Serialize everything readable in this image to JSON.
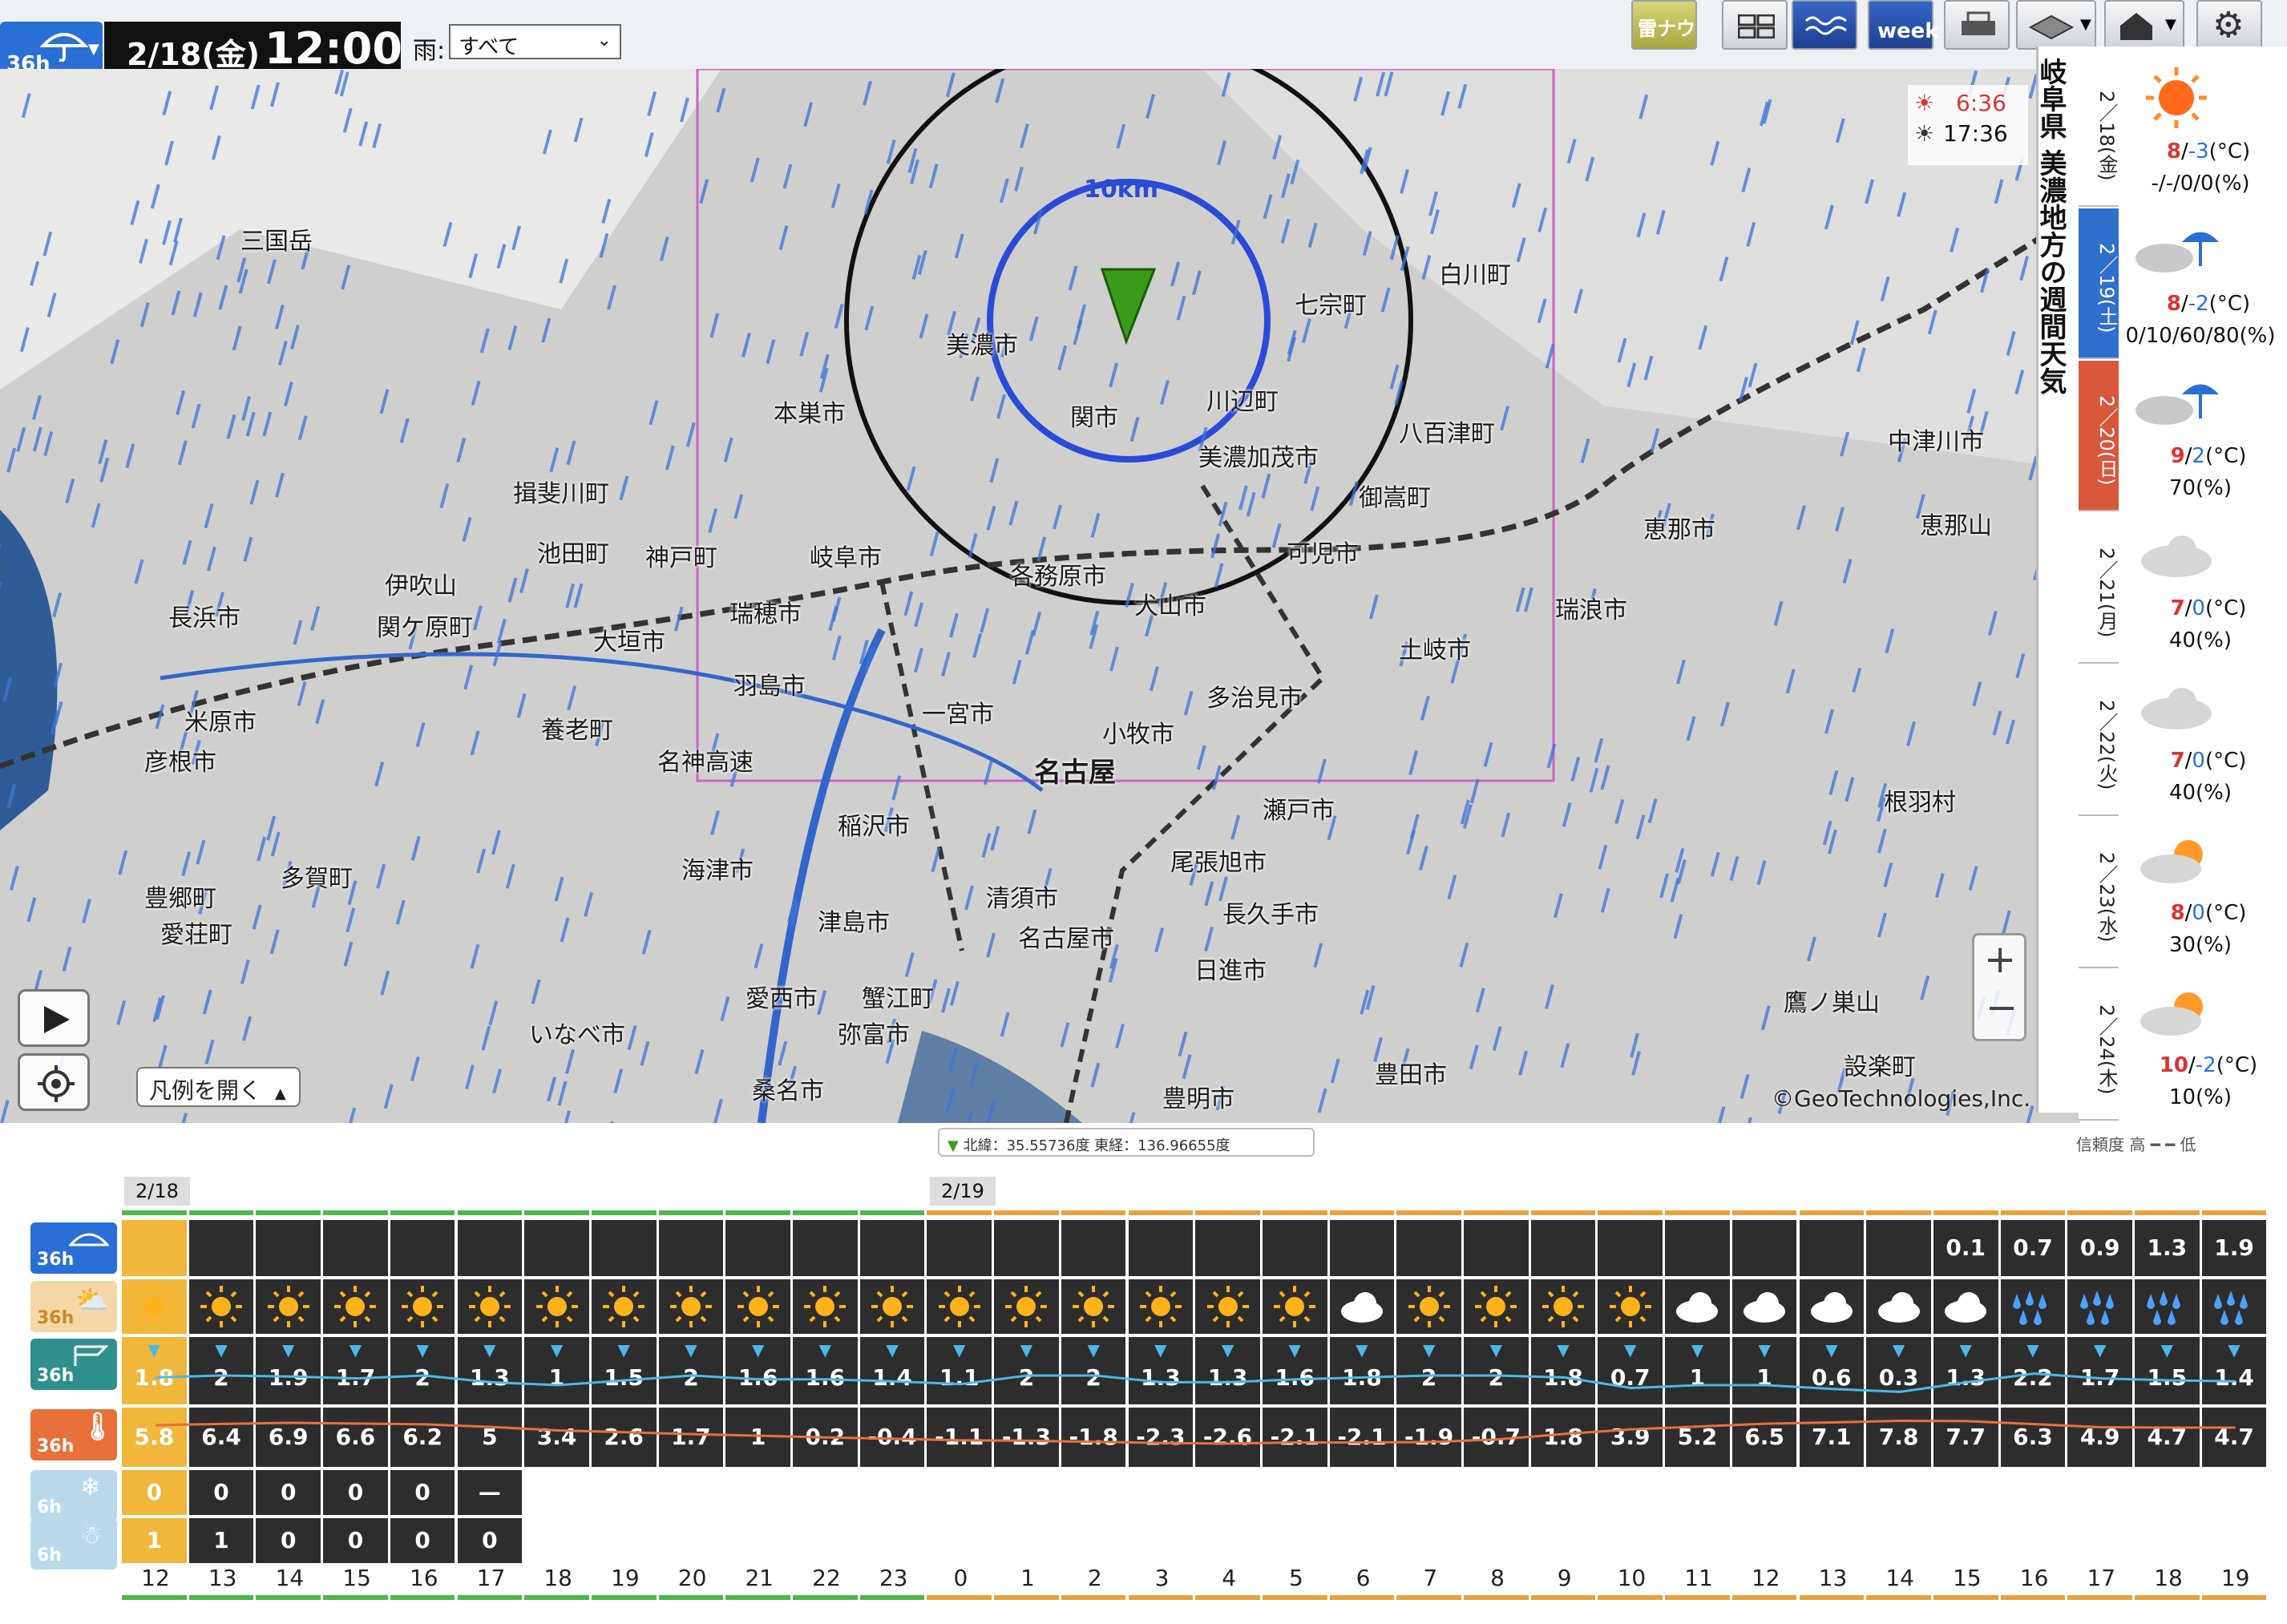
{
  "topbar": {
    "mode_label": "36h",
    "date": "2/18(金)",
    "time": "12:00",
    "rain_label": "雨:",
    "rain_select": "すべて",
    "thunder_btn": "雷ナウ",
    "week_btn": "week"
  },
  "map": {
    "towns": [
      "三国岳",
      "揖斐川町",
      "池田町",
      "伊吹山",
      "長浜市",
      "米原市",
      "彦根市",
      "関ケ原町",
      "大垣市",
      "神戸町",
      "瑞穂市",
      "岐阜市",
      "本巣市",
      "美濃市",
      "関市",
      "七宗町",
      "白川町",
      "川辺町",
      "八百津町",
      "美濃加茂市",
      "御嵩町",
      "可児市",
      "各務原市",
      "犬山市",
      "羽島市",
      "養老町",
      "一宮市",
      "小牧市",
      "多治見市",
      "土岐市",
      "瑞浪市",
      "恵那市",
      "中津川市",
      "恵那山",
      "名古屋",
      "稲沢市",
      "瀬戸市",
      "尾張旭市",
      "長久手市",
      "日進市",
      "清須市",
      "名古屋市",
      "津島市",
      "海津市",
      "愛西市",
      "蟹江町",
      "弥富市",
      "桑名市",
      "豊明市",
      "豊田市",
      "設楽町",
      "根羽村",
      "多賀町",
      "豊郷町",
      "愛荘町",
      "いなべ市",
      "名神高速",
      "鷹ノ巣山"
    ],
    "radius_label": "10km",
    "sunrise": "6:36",
    "sunset": "17:36",
    "copyright": "©GeoTechnologies,Inc.",
    "legend_btn": "凡例を開く"
  },
  "week": {
    "title": "岐阜県 美濃地方の週間天気",
    "days": [
      {
        "date": "2／18(金)",
        "icon": "sun-icon",
        "high": "8",
        "low": "-3",
        "unit": "(°C)",
        "pop": "-/-/0/0(%)",
        "bg": "#ffffff"
      },
      {
        "date": "2／19(土)",
        "icon": "cloud-rain-icon",
        "high": "8",
        "low": "-2",
        "unit": "(°C)",
        "pop": "0/10/60/80(%)",
        "bg": "#2f6fce"
      },
      {
        "date": "2／20(日)",
        "icon": "cloud-rain-icon",
        "high": "9",
        "low": "2",
        "unit": "(°C)",
        "pop": "70(%)",
        "bg": "#d9573a"
      },
      {
        "date": "2／21(月)",
        "icon": "cloud-icon",
        "high": "7",
        "low": "0",
        "unit": "(°C)",
        "pop": "40(%)",
        "bg": "#ffffff"
      },
      {
        "date": "2／22(火)",
        "icon": "cloud-icon",
        "high": "7",
        "low": "0",
        "unit": "(°C)",
        "pop": "40(%)",
        "bg": "#ffffff"
      },
      {
        "date": "2／23(水)",
        "icon": "cloud-sun-icon",
        "high": "8",
        "low": "0",
        "unit": "(°C)",
        "pop": "30(%)",
        "bg": "#ffffff"
      },
      {
        "date": "2／24(木)",
        "icon": "sun-cloud-icon",
        "high": "10",
        "low": "-2",
        "unit": "(°C)",
        "pop": "10(%)",
        "bg": "#ffffff"
      }
    ]
  },
  "bottom": {
    "coords": "北緯：35.55736度  東経：136.96655度",
    "reliability": "信頼度 高 ━ ━ 低",
    "date_tags": [
      "2/18",
      "2/19"
    ],
    "row_labels": [
      "36h",
      "36h",
      "36h",
      "36h",
      "6h",
      "6h"
    ],
    "hours": [
      "12",
      "13",
      "14",
      "15",
      "16",
      "17",
      "18",
      "19",
      "20",
      "21",
      "22",
      "23",
      "0",
      "1",
      "2",
      "3",
      "4",
      "5",
      "6",
      "7",
      "8",
      "9",
      "10",
      "11",
      "12",
      "13",
      "14",
      "15",
      "16",
      "17",
      "18",
      "19"
    ],
    "precip": [
      "",
      "",
      "",
      "",
      "",
      "",
      "",
      "",
      "",
      "",
      "",
      "",
      "",
      "",
      "",
      "",
      "",
      "",
      "",
      "",
      "",
      "",
      "",
      "",
      "",
      "",
      "",
      "0.1",
      "0.7",
      "0.9",
      "1.3",
      "1.9"
    ],
    "weather": [
      "sun",
      "sun",
      "sun",
      "sun",
      "sun",
      "sun",
      "sun",
      "sun",
      "sun",
      "sun",
      "sun",
      "sun",
      "sun",
      "sun",
      "sun",
      "sun",
      "sun",
      "sun",
      "cloud",
      "sun",
      "sun",
      "sun",
      "sun",
      "cloud",
      "cloud",
      "cloud",
      "cloud",
      "cloud",
      "rain",
      "rain",
      "rain",
      "rain"
    ],
    "wind": [
      "1.8",
      "2",
      "1.9",
      "1.7",
      "2",
      "1.3",
      "1",
      "1.5",
      "2",
      "1.6",
      "1.6",
      "1.4",
      "1.1",
      "2",
      "2",
      "1.3",
      "1.3",
      "1.6",
      "1.8",
      "2",
      "2",
      "1.8",
      "0.7",
      "1",
      "1",
      "0.6",
      "0.3",
      "1.3",
      "2.2",
      "1.7",
      "1.5",
      "1.4"
    ],
    "temp": [
      "5.8",
      "6.4",
      "6.9",
      "6.6",
      "6.2",
      "5",
      "3.4",
      "2.6",
      "1.7",
      "1",
      "0.2",
      "-0.4",
      "-1.1",
      "-1.3",
      "-1.8",
      "-2.3",
      "-2.6",
      "-2.1",
      "-2.1",
      "-1.9",
      "-0.7",
      "1.8",
      "3.9",
      "5.2",
      "6.5",
      "7.1",
      "7.8",
      "7.7",
      "6.3",
      "4.9",
      "4.7",
      "4.7"
    ],
    "snowfall": [
      "0",
      "0",
      "0",
      "0",
      "0",
      "—"
    ],
    "snowdepth": [
      "1",
      "1",
      "0",
      "0",
      "0",
      "0"
    ]
  },
  "colors": {
    "accent": "#2a6fd6",
    "current_col": "#f0b73a",
    "rain_streak": "#3b74d8"
  }
}
